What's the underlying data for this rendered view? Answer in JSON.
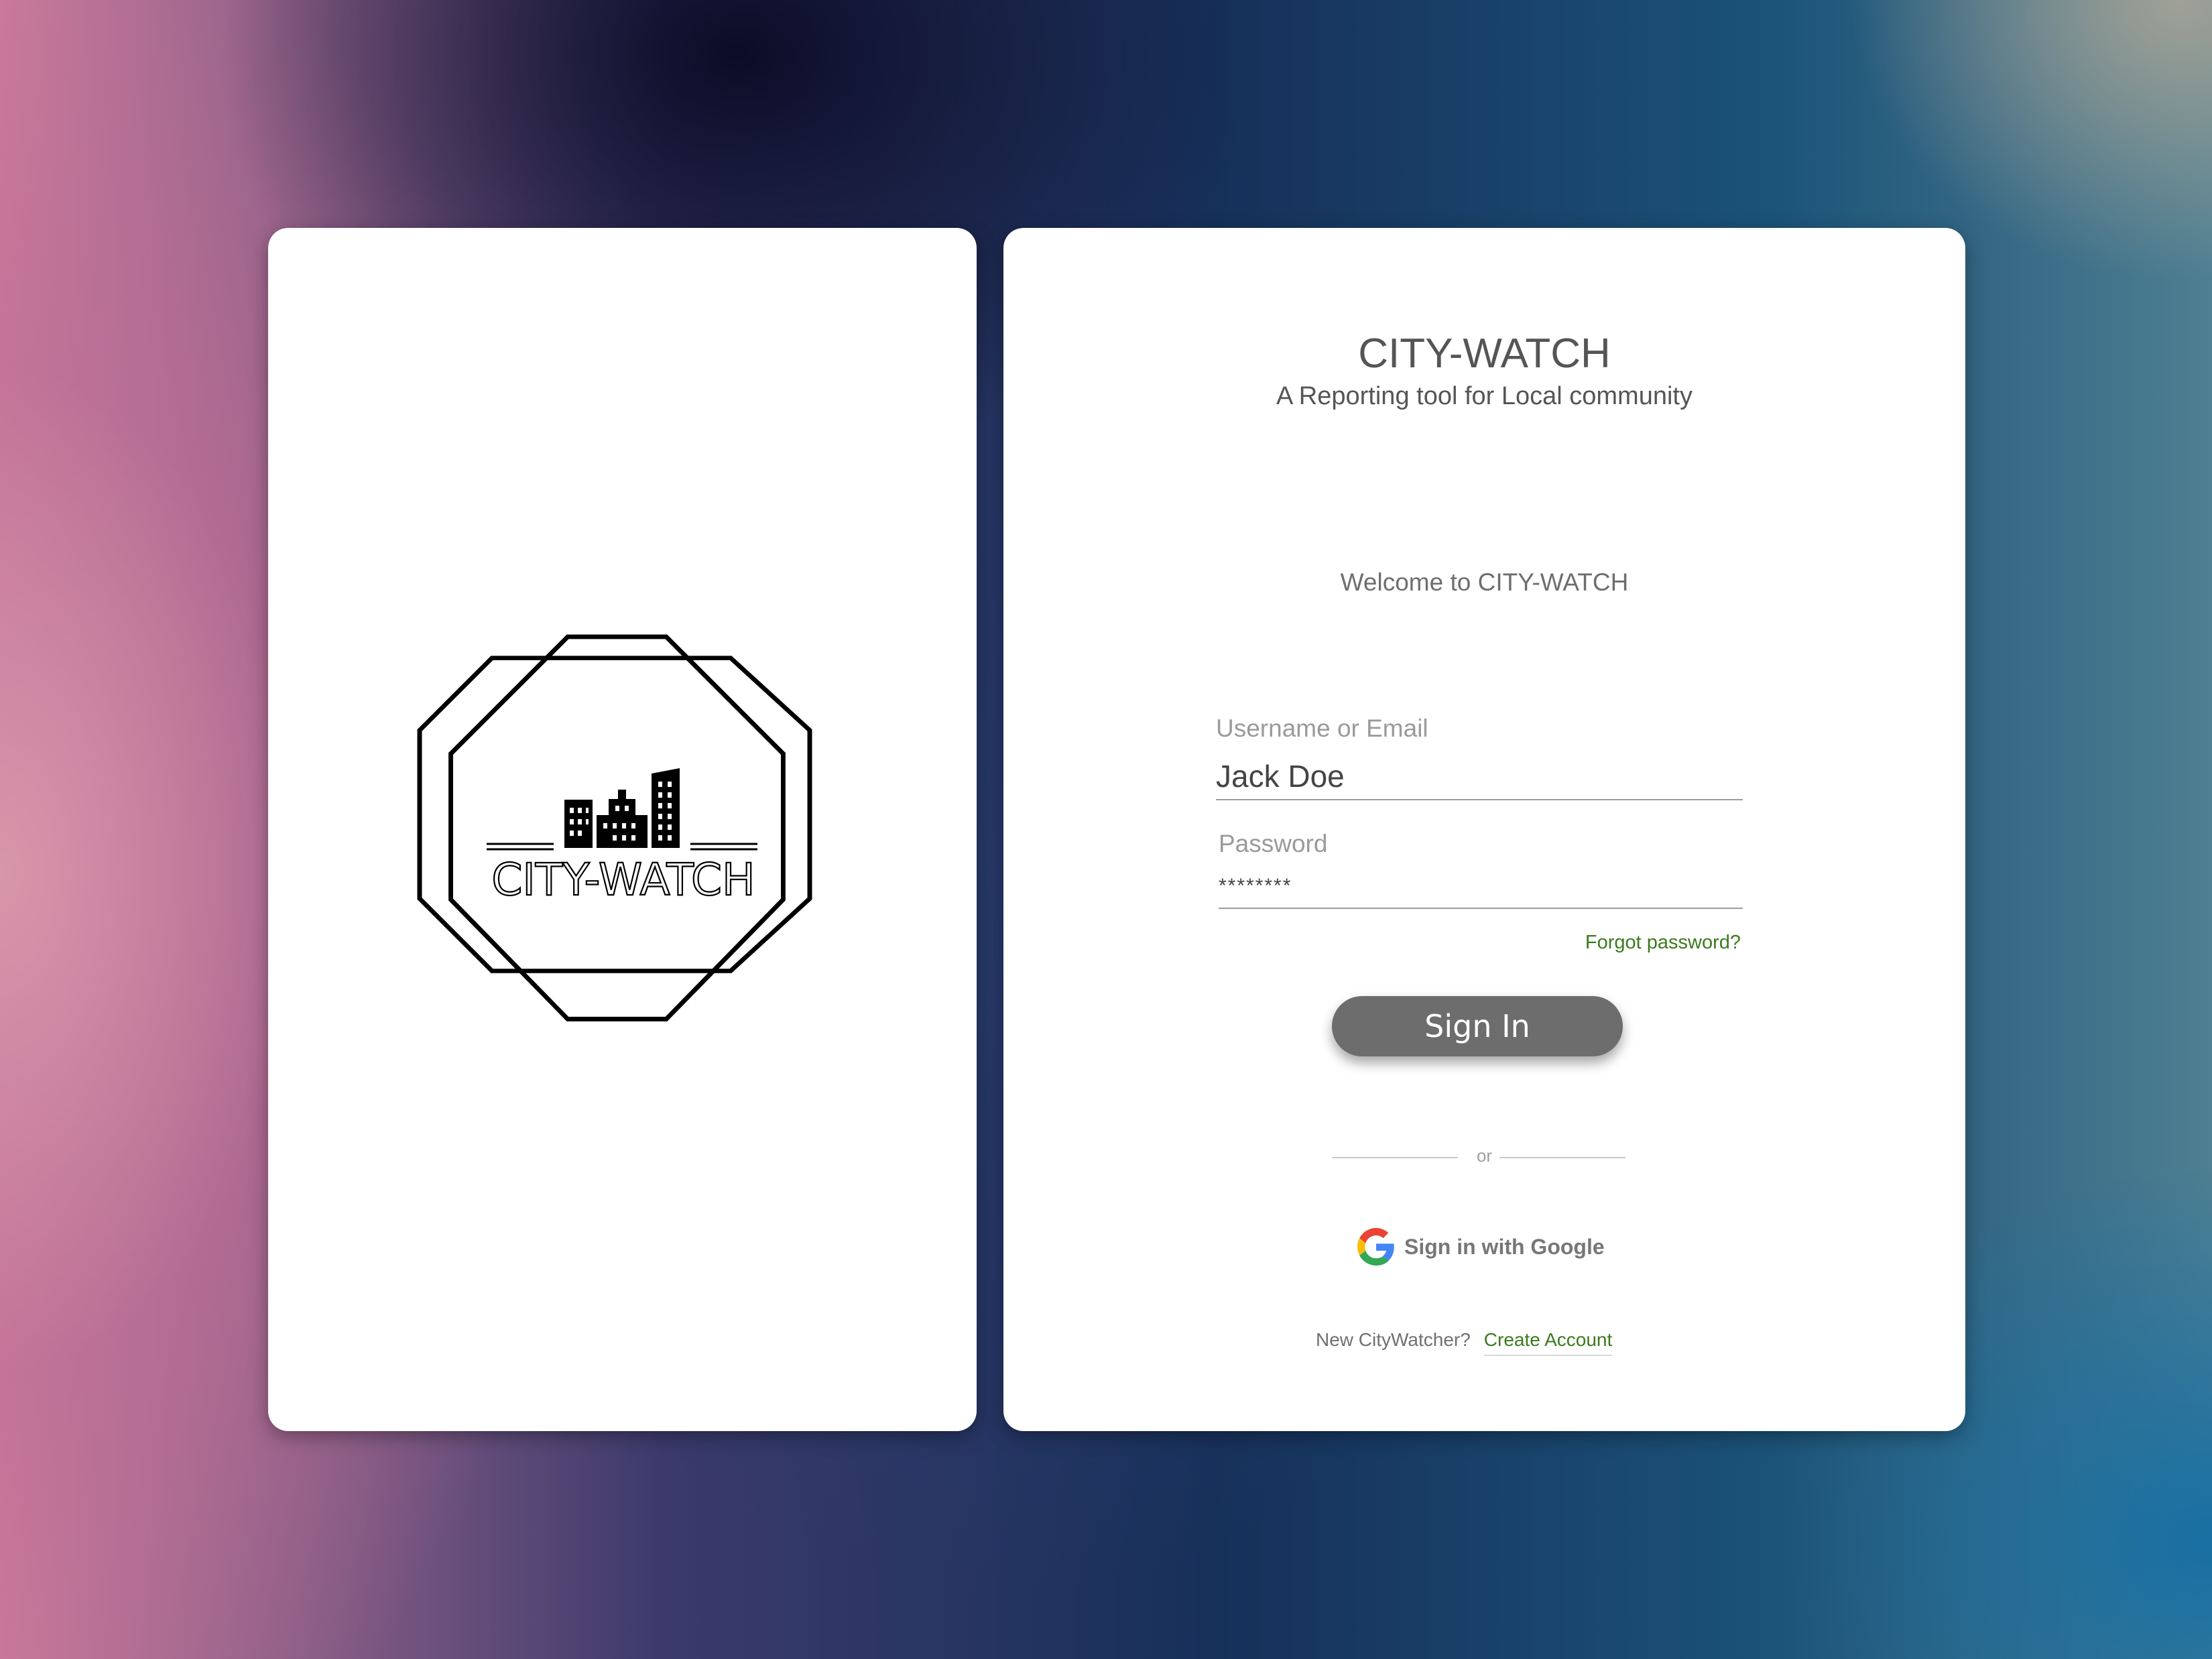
{
  "logo": {
    "text": "CITY-WATCH"
  },
  "header": {
    "title": "CITY-WATCH",
    "subtitle": "A Reporting tool for Local community"
  },
  "welcome": "Welcome to CITY-WATCH",
  "form": {
    "username_label": "Username or Email",
    "username_value": "Jack Doe",
    "password_label": "Password",
    "password_value": "********",
    "forgot_link": "Forgot password?",
    "signin_label": "Sign In",
    "divider_text": "or",
    "google_label": "Sign in with Google",
    "new_user_text": "New CityWatcher?",
    "create_account_link": "Create Account"
  },
  "icons": {
    "google": "google-g-icon",
    "logo": "city-skyline-octagon-logo"
  },
  "colors": {
    "link": "#3b7a1e",
    "button": "#6d6d6d",
    "text": "#555555"
  }
}
